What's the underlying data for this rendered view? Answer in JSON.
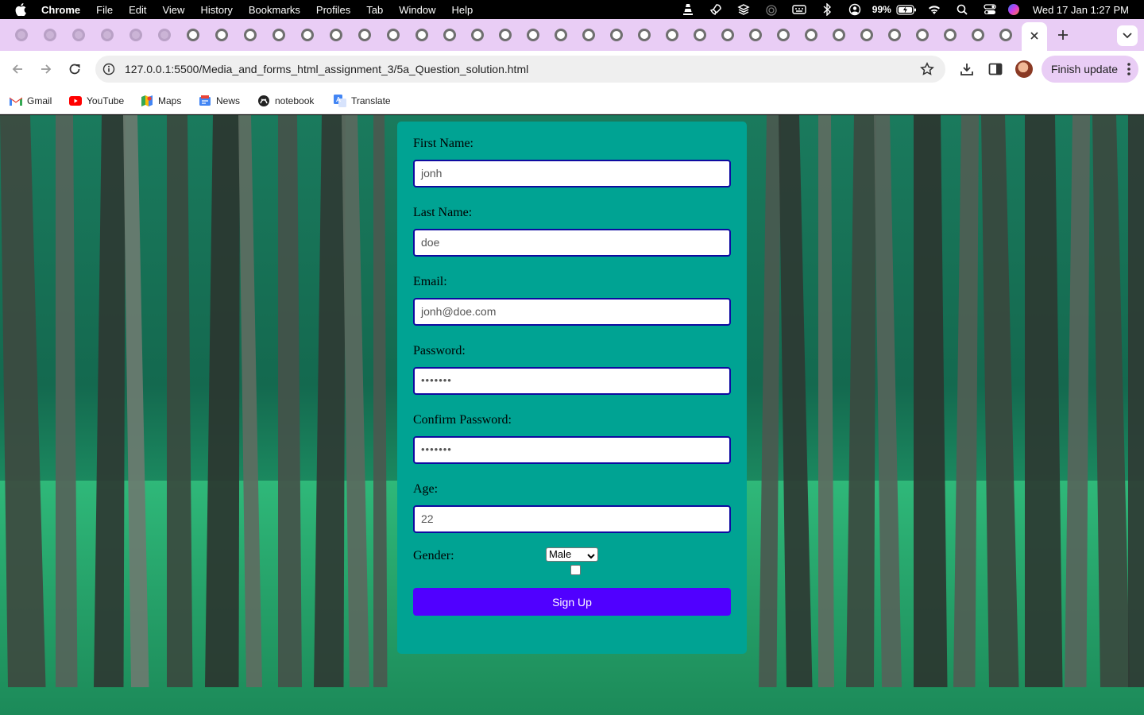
{
  "menubar": {
    "app_name": "Chrome",
    "items": [
      "File",
      "Edit",
      "View",
      "History",
      "Bookmarks",
      "Profiles",
      "Tab",
      "Window",
      "Help"
    ],
    "battery": "99%",
    "clock": "Wed 17 Jan  1:27 PM"
  },
  "toolbar": {
    "url": "127.0.0.1:5500/Media_and_forms_html_assignment_3/5a_Question_solution.html",
    "finish_update_label": "Finish update"
  },
  "bookmarks": [
    {
      "label": "Gmail",
      "icon": "gmail-icon"
    },
    {
      "label": "YouTube",
      "icon": "youtube-icon"
    },
    {
      "label": "Maps",
      "icon": "maps-icon"
    },
    {
      "label": "News",
      "icon": "news-icon"
    },
    {
      "label": "notebook",
      "icon": "notebook-icon"
    },
    {
      "label": "Translate",
      "icon": "translate-icon"
    }
  ],
  "form": {
    "first_name_label": "First Name:",
    "first_name_value": "jonh",
    "last_name_label": "Last Name:",
    "last_name_value": "doe",
    "email_label": "Email:",
    "email_value": "jonh@doe.com",
    "password_label": "Password:",
    "password_value": "•••••••",
    "confirm_password_label": "Confirm Password:",
    "confirm_password_value": "•••••••",
    "age_label": "Age:",
    "age_value": "22",
    "gender_label": "Gender:",
    "gender_selected": "Male",
    "checkbox_checked": false,
    "signup_label": "Sign Up"
  },
  "colors": {
    "card_bg": "#00a393",
    "input_border": "#0e0aa0",
    "button_bg": "#5000ff",
    "tabstrip_bg": "#e9cdf5"
  }
}
